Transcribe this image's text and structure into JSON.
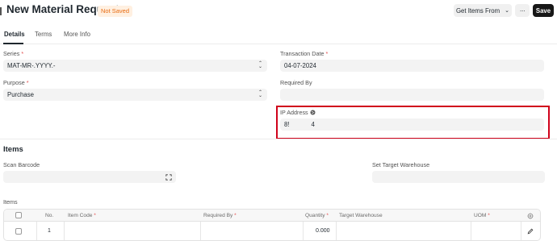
{
  "header": {
    "title": "New Material Request",
    "status": "Not Saved",
    "get_items_label": "Get Items From",
    "more_label": "···",
    "save_label": "Save"
  },
  "tabs": [
    {
      "label": "Details",
      "active": true
    },
    {
      "label": "Terms",
      "active": false
    },
    {
      "label": "More Info",
      "active": false
    }
  ],
  "fields": {
    "series": {
      "label": "Series",
      "value": "MAT-MR-.YYYY.-"
    },
    "transaction_date": {
      "label": "Transaction Date",
      "value": "04-07-2024"
    },
    "purpose": {
      "label": "Purpose",
      "value": "Purchase"
    },
    "required_by": {
      "label": "Required By",
      "value": ""
    },
    "ip_address": {
      "label": "IP Address",
      "value_left": "8!",
      "value_right": "4"
    }
  },
  "items_section": {
    "title": "Items",
    "scan_barcode_label": "Scan Barcode",
    "set_target_warehouse_label": "Set Target Warehouse",
    "table_label": "Items"
  },
  "table": {
    "headers": {
      "no": "No.",
      "item_code": "Item Code",
      "required_by": "Required By",
      "quantity": "Quantity",
      "target_warehouse": "Target Warehouse",
      "uom": "UOM"
    },
    "rows": [
      {
        "no": "1",
        "item_code": "",
        "required_by": "",
        "quantity": "0.000",
        "target_warehouse": "",
        "uom": ""
      }
    ]
  },
  "colors": {
    "status_badge_text": "#e86c13",
    "status_badge_bg": "#fff0e1",
    "required_asterisk": "#e24c4c",
    "highlight_border": "#d0021b",
    "save_button_bg": "#171717"
  },
  "icons": [
    "globe-icon",
    "scan-icon",
    "settings-icon",
    "edit-icon",
    "select-arrows-icon"
  ]
}
